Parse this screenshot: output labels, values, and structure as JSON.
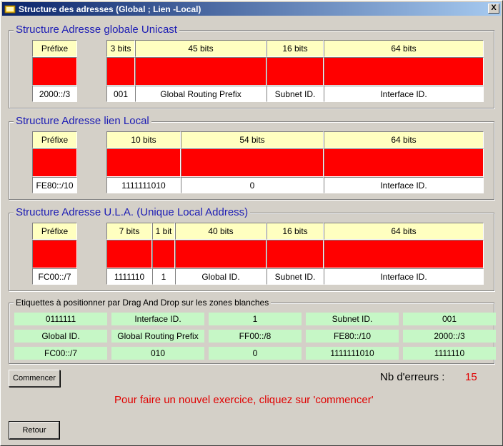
{
  "window": {
    "title": "Structure des adresses (Global ; Lien -Local)",
    "close_glyph": "X"
  },
  "global": {
    "title": "Structure Adresse globale Unicast",
    "prefix_header": "Préfixe",
    "prefix_value": "2000::/3",
    "headers": [
      "3 bits",
      "45 bits",
      "16 bits",
      "64 bits"
    ],
    "values": [
      "001",
      "Global Routing Prefix",
      "Subnet ID.",
      "Interface ID."
    ]
  },
  "linklocal": {
    "title": "Structure Adresse lien Local",
    "prefix_header": "Préfixe",
    "prefix_value": "FE80::/10",
    "headers": [
      "10 bits",
      "54 bits",
      "64 bits"
    ],
    "values": [
      "1111111010",
      "0",
      "Interface ID."
    ]
  },
  "ula": {
    "title": "Structure Adresse U.L.A. (Unique Local Address)",
    "prefix_header": "Préfixe",
    "prefix_value": "FC00::/7",
    "headers": [
      "7 bits",
      "1 bit",
      "40 bits",
      "16 bits",
      "64 bits"
    ],
    "values": [
      "1111110",
      "1",
      "Global ID.",
      "Subnet ID.",
      "Interface ID."
    ]
  },
  "labels": {
    "title": "Etiquettes à positionner par Drag And Drop sur les zones blanches",
    "items": [
      "0111111",
      "Interface ID.",
      "1",
      "Subnet ID.",
      "001",
      "Global ID.",
      "Global Routing Prefix",
      "FF00::/8",
      "FE80::/10",
      "2000::/3",
      "FC00::/7",
      "010",
      "0",
      "1111111010",
      "1111110"
    ]
  },
  "controls": {
    "start_label": "Commencer",
    "back_label": "Retour",
    "errors_label": "Nb d'erreurs :",
    "errors_count": "15",
    "message": "Pour faire un nouvel exercice, cliquez sur 'commencer'"
  },
  "colors": {
    "header": "#ffffc0",
    "zone": "#ff0000",
    "label": "#c6f7c6",
    "title_text": "#1c1cb4",
    "message": "#e00000"
  }
}
